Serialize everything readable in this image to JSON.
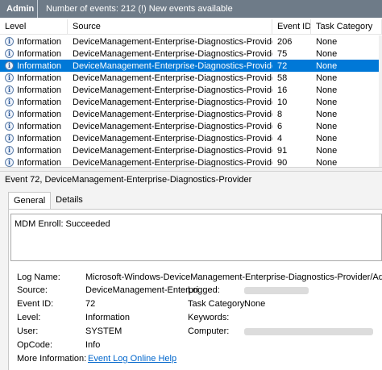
{
  "header": {
    "log_name": "Admin",
    "status": "Number of events: 212 (!) New events available"
  },
  "columns": [
    "Level",
    "Source",
    "Event ID",
    "Task Category"
  ],
  "events": [
    {
      "level": "Information",
      "source": "DeviceManagement-Enterprise-Diagnostics-Provider",
      "event_id": "206",
      "category": "None"
    },
    {
      "level": "Information",
      "source": "DeviceManagement-Enterprise-Diagnostics-Provider",
      "event_id": "75",
      "category": "None"
    },
    {
      "level": "Information",
      "source": "DeviceManagement-Enterprise-Diagnostics-Provider",
      "event_id": "72",
      "category": "None"
    },
    {
      "level": "Information",
      "source": "DeviceManagement-Enterprise-Diagnostics-Provider",
      "event_id": "58",
      "category": "None"
    },
    {
      "level": "Information",
      "source": "DeviceManagement-Enterprise-Diagnostics-Provider",
      "event_id": "16",
      "category": "None"
    },
    {
      "level": "Information",
      "source": "DeviceManagement-Enterprise-Diagnostics-Provider",
      "event_id": "10",
      "category": "None"
    },
    {
      "level": "Information",
      "source": "DeviceManagement-Enterprise-Diagnostics-Provider",
      "event_id": "8",
      "category": "None"
    },
    {
      "level": "Information",
      "source": "DeviceManagement-Enterprise-Diagnostics-Provider",
      "event_id": "6",
      "category": "None"
    },
    {
      "level": "Information",
      "source": "DeviceManagement-Enterprise-Diagnostics-Provider",
      "event_id": "4",
      "category": "None"
    },
    {
      "level": "Information",
      "source": "DeviceManagement-Enterprise-Diagnostics-Provider",
      "event_id": "91",
      "category": "None"
    },
    {
      "level": "Information",
      "source": "DeviceManagement-Enterprise-Diagnostics-Provider",
      "event_id": "90",
      "category": "None"
    }
  ],
  "selected_index": 2,
  "icons": {
    "level": "info-icon"
  },
  "colors": {
    "selection": "#0078d7",
    "titlebar": "#6e7b88",
    "link": "#0066cc"
  },
  "detail": {
    "title": "Event 72, DeviceManagement-Enterprise-Diagnostics-Provider",
    "tabs": [
      "General",
      "Details"
    ],
    "message": "MDM Enroll: Succeeded",
    "labels": {
      "log_name": "Log Name:",
      "source": "Source:",
      "event_id": "Event ID:",
      "level": "Level:",
      "user": "User:",
      "opcode": "OpCode:",
      "more_info": "More Information:",
      "logged": "Logged:",
      "task_category": "Task Category:",
      "keywords": "Keywords:",
      "computer": "Computer:"
    },
    "values": {
      "log_name": "Microsoft-Windows-DeviceManagement-Enterprise-Diagnostics-Provider/Admin",
      "source": "DeviceManagement-Enterpri",
      "event_id": "72",
      "level": "Information",
      "user": "SYSTEM",
      "opcode": "Info",
      "more_info_link": "Event Log Online Help",
      "task_category": "None"
    }
  }
}
